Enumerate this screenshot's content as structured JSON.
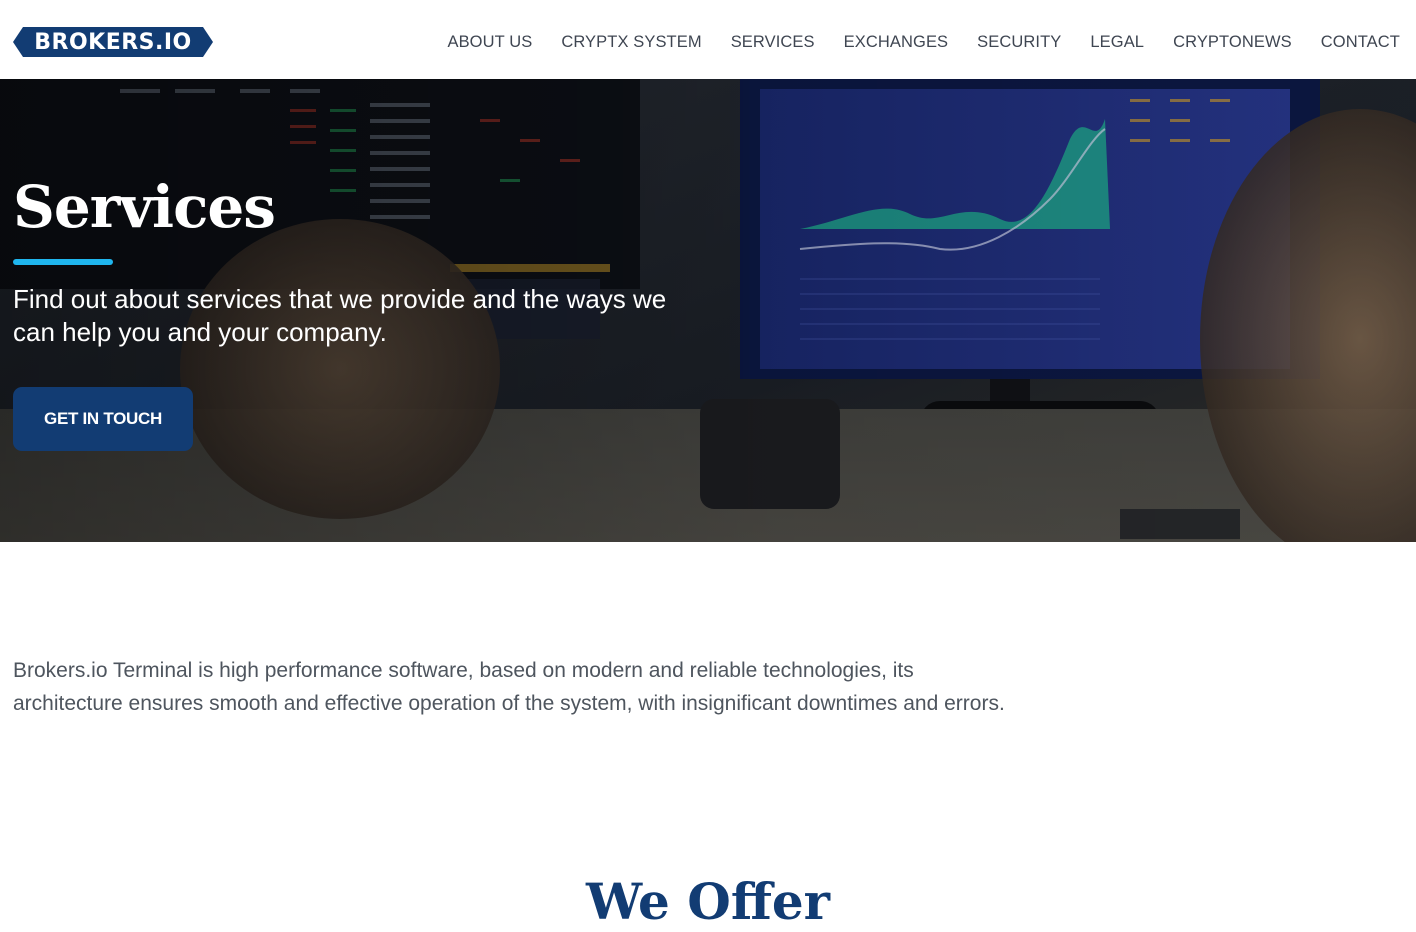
{
  "brand": {
    "logo_text": "BROKERS.IO",
    "color": "#123c73"
  },
  "nav": {
    "items": [
      {
        "label": "ABOUT US"
      },
      {
        "label": "CRYPTX SYSTEM"
      },
      {
        "label": "SERVICES"
      },
      {
        "label": "EXCHANGES"
      },
      {
        "label": "SECURITY"
      },
      {
        "label": "LEGAL"
      },
      {
        "label": "CRYPTONEWS"
      },
      {
        "label": "CONTACT"
      }
    ]
  },
  "hero": {
    "title": "Services",
    "subtitle": "Find out about services that we provide and the ways we can help you and your company.",
    "cta_label": "GET IN TOUCH",
    "accent_color": "#1fb6ee"
  },
  "intro": {
    "text": "Brokers.io Terminal is high performance software, based on modern and reliable technologies, its architecture ensures smooth and effective operation of the system, with insignificant downtimes and errors."
  },
  "offer": {
    "title": "We Offer"
  }
}
